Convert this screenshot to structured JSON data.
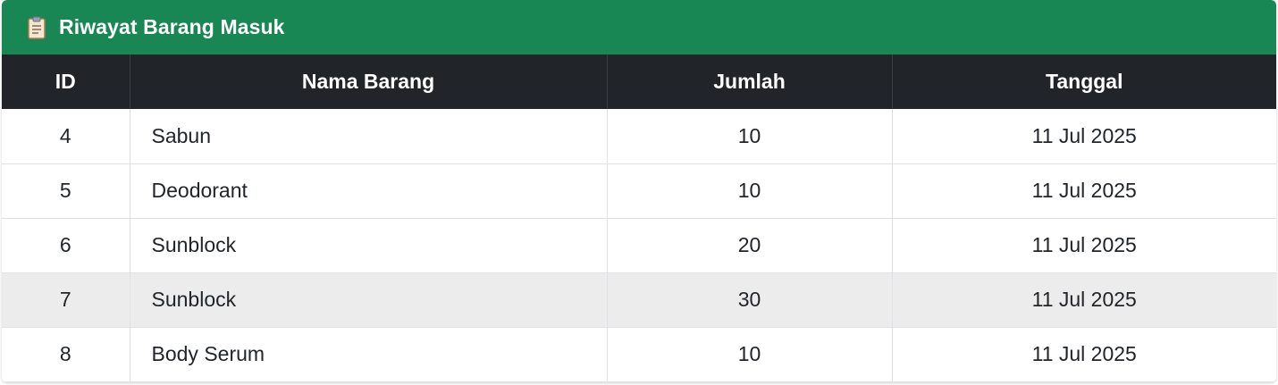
{
  "header": {
    "title": "Riwayat Barang Masuk",
    "icon": "clipboard-icon",
    "color": "#198754"
  },
  "table": {
    "columns": [
      "ID",
      "Nama Barang",
      "Jumlah",
      "Tanggal"
    ],
    "rows": [
      {
        "id": "4",
        "name": "Sabun",
        "qty": "10",
        "date": "11 Jul 2025"
      },
      {
        "id": "5",
        "name": "Deodorant",
        "qty": "10",
        "date": "11 Jul 2025"
      },
      {
        "id": "6",
        "name": "Sunblock",
        "qty": "20",
        "date": "11 Jul 2025"
      },
      {
        "id": "7",
        "name": "Sunblock",
        "qty": "30",
        "date": "11 Jul 2025"
      },
      {
        "id": "8",
        "name": "Body Serum",
        "qty": "10",
        "date": "11 Jul 2025"
      }
    ],
    "header_bg": "#212529",
    "highlighted_row_index": 3
  }
}
